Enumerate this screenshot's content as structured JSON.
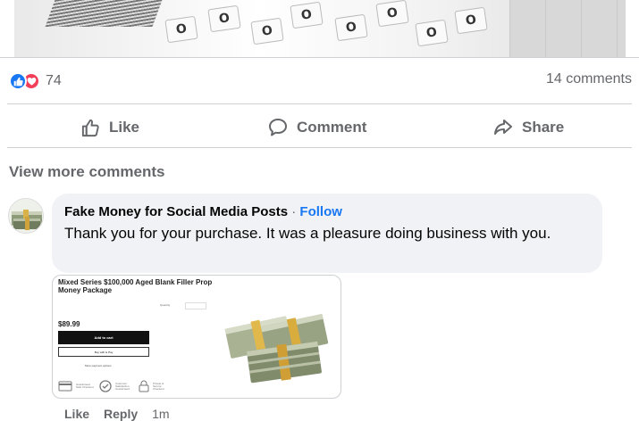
{
  "post": {
    "reactions": {
      "count": "74",
      "types": [
        "like-icon",
        "love-icon"
      ]
    },
    "comments_count": "14 comments"
  },
  "actions": {
    "like": "Like",
    "comment": "Comment",
    "share": "Share"
  },
  "view_more": "View more comments",
  "comment": {
    "author": "Fake Money for Social Media Posts",
    "separator": "·",
    "follow": "Follow",
    "text": "Thank you for your purchase. It was a pleasure doing business with you.",
    "attachment": {
      "title": "Mixed Series $100,000 Aged Blank Filler Prop Money Package",
      "quantity_label": "Quantity",
      "price": "$89.99",
      "add_to_cart": "Add to cart",
      "gpay": "Buy with G Pay",
      "more_payment": "More payment options",
      "badges": [
        "Guaranteed Safe Checkout",
        "Customer Satisfaction Guaranteed",
        "Private & Secure Checkout"
      ]
    },
    "meta": {
      "like": "Like",
      "reply": "Reply",
      "time": "1m"
    }
  },
  "colors": {
    "accent": "#1877f2",
    "love": "#f33e58",
    "muted": "#65676b",
    "bubble": "#f0f2f5"
  }
}
